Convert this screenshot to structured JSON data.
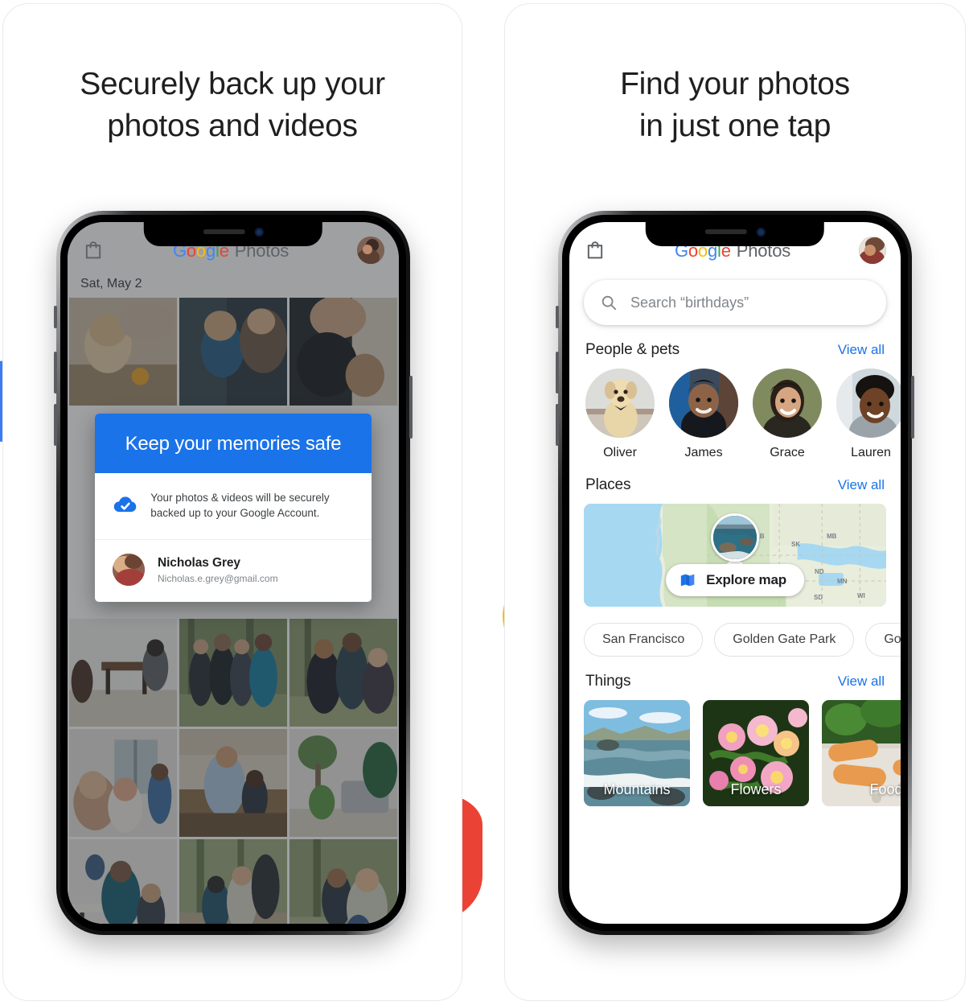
{
  "panels": [
    {
      "headline_line1": "Securely back up your",
      "headline_line2": "photos and videos"
    },
    {
      "headline_line1": "Find your photos",
      "headline_line2": "in just one tap"
    }
  ],
  "brand": {
    "g": "G",
    "o1": "o",
    "o2": "o",
    "g2": "g",
    "l": "l",
    "e": "e",
    "word": "Photos"
  },
  "phone1": {
    "date_label": "Sat, May 2",
    "dialog": {
      "title": "Keep your memories safe",
      "body": "Your photos & videos will be securely backed up to your Google Account.",
      "account_name": "Nicholas Grey",
      "account_email": "Nicholas.e.grey@gmail.com",
      "check_icon": "cloud-check-icon"
    },
    "shopping_icon": "shopping-bag-icon",
    "avatar_icon": "profile-avatar"
  },
  "phone2": {
    "search": {
      "placeholder": "Search “birthdays”",
      "icon": "search-icon"
    },
    "sections": [
      {
        "title": "People & pets",
        "view_all": "View all"
      },
      {
        "title": "Places",
        "view_all": "View all"
      },
      {
        "title": "Things",
        "view_all": "View all"
      }
    ],
    "people": [
      {
        "name": "Oliver"
      },
      {
        "name": "James"
      },
      {
        "name": "Grace"
      },
      {
        "name": "Lauren"
      }
    ],
    "map": {
      "explore_label": "Explore map",
      "explore_icon": "map-icon",
      "region_labels": [
        "AB",
        "SK",
        "MB",
        "ND",
        "MN",
        "WI",
        "SD"
      ]
    },
    "place_chips": [
      "San Francisco",
      "Golden Gate Park",
      "Golden"
    ],
    "things": [
      {
        "label": "Mountains"
      },
      {
        "label": "Flowers"
      },
      {
        "label": "Food"
      }
    ],
    "shopping_icon": "shopping-bag-icon",
    "avatar_icon": "profile-avatar"
  },
  "decor": {
    "blue": "#3b7cf5",
    "yellow": "#fbbc04",
    "red": "#ea4335",
    "dots": "#dadce0",
    "accent_blue": "#1a73e8"
  }
}
